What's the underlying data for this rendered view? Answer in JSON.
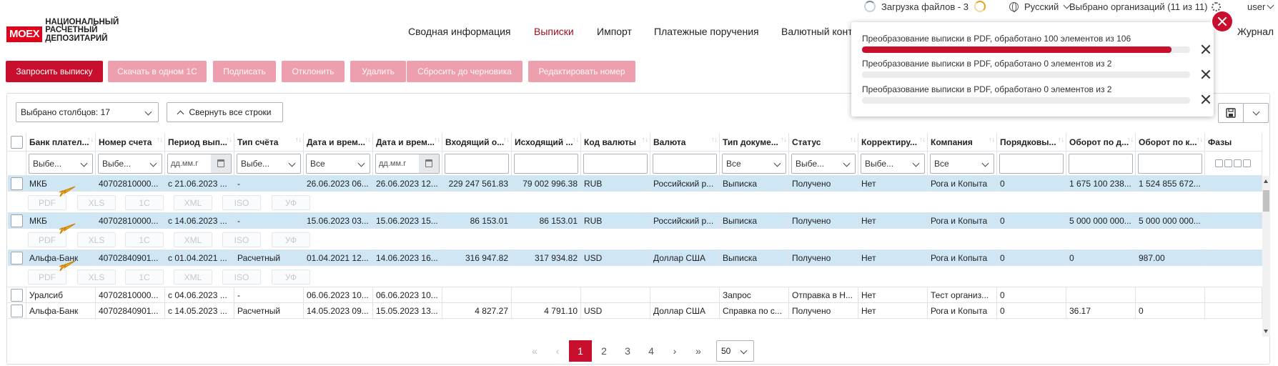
{
  "topbar": {
    "upload_label": "Загрузка файлов - 3",
    "language": "Русский",
    "orgs": "Выбрано организаций (11 из 11)",
    "user": "user"
  },
  "logo": {
    "mark": "MOEX",
    "line1": "НАЦИОНАЛЬНЫЙ",
    "line2": "РАСЧЕТНЫЙ",
    "line3": "ДЕПОЗИТАРИЙ"
  },
  "nav": [
    {
      "label": "Сводная информация"
    },
    {
      "label": "Выписки"
    },
    {
      "label": "Импорт"
    },
    {
      "label": "Платежные поручения"
    },
    {
      "label": "Валютный конт"
    },
    {
      "label": "Журнал"
    }
  ],
  "actions": [
    {
      "label": "Запросить выписку"
    },
    {
      "label": "Скачать в одном 1С"
    },
    {
      "label": "Подписать"
    },
    {
      "label": "Отклонить"
    },
    {
      "label": "Удалить"
    },
    {
      "label": "Сбросить до черновика"
    },
    {
      "label": "Редактировать номер"
    }
  ],
  "toolbar": {
    "columns_select": "Выбрано столбцов: 17",
    "collapse": "Свернуть все строки"
  },
  "columns": [
    "Банк плател...",
    "Номер счета",
    "Период вып...",
    "Тип счёта",
    "Дата и врем...",
    "Дата и врем...",
    "Входящий о...",
    "Исходящий ...",
    "Код валюты",
    "Валюта",
    "Тип докуме...",
    "Статус",
    "Корректиру...",
    "Компания",
    "Порядковы...",
    "Оборот по д...",
    "Оборот по к...",
    "Фазы"
  ],
  "filters": {
    "choose": "Выбе...",
    "all": "Все",
    "date": "дд.мм.г"
  },
  "rows": [
    [
      "МКБ",
      "40702810000...",
      "с 21.06.2023 ...",
      "-",
      "26.06.2023 06...",
      "26.06.2023 12...",
      "229 247 561.83",
      "79 002 996.38",
      "RUB",
      "Российский р...",
      "Выписка",
      "Получено",
      "Нет",
      "Рога и Копыта",
      "0",
      "1 675 100 238...",
      "1 524 855 672...",
      ""
    ],
    [
      "МКБ",
      "40702810000...",
      "с 14.06.2023 ...",
      "-",
      "15.06.2023 03...",
      "15.06.2023 15...",
      "86 153.01",
      "86 153.01",
      "RUB",
      "Российский р...",
      "Выписка",
      "Получено",
      "Нет",
      "Рога и Копыта",
      "0",
      "5 000 000 000...",
      "5 000 000 000...",
      ""
    ],
    [
      "Альфа-Банк",
      "40702840901...",
      "с 01.04.2021 ...",
      "Расчетный",
      "01.04.2021 12...",
      "14.06.2023 16...",
      "316 947.82",
      "317 934.82",
      "USD",
      "Доллар США",
      "Выписка",
      "Получено",
      "Нет",
      "Рога и Копыта",
      "0",
      "0",
      "987.00",
      ""
    ],
    [
      "Уралсиб",
      "40702810000...",
      "с 04.06.2023 ...",
      "-",
      "06.06.2023 10...",
      "06.06.2023 10...",
      "",
      "",
      "",
      "",
      "Запрос",
      "Отправка в Н...",
      "Нет",
      "Тест организ...",
      "0",
      "",
      "",
      ""
    ],
    [
      "Альфа-Банк",
      "40702840901...",
      "с 14.05.2023 ...",
      "Расчетный",
      "14.05.2023 09...",
      "15.05.2023 13...",
      "4 827.27",
      "4 791.10",
      "USD",
      "Доллар США",
      "Справка по с...",
      "Получено",
      "Нет",
      "Рога и Копыта",
      "0",
      "36.17",
      "0",
      ""
    ]
  ],
  "export_buttons": [
    "PDF",
    "XLS",
    "1C",
    "XML",
    "ISO",
    "УФ"
  ],
  "pager": {
    "first": "«",
    "prev": "‹",
    "pages": [
      "1",
      "2",
      "3",
      "4"
    ],
    "next": "›",
    "last": "»",
    "page_size": "50"
  },
  "notifications": [
    {
      "text": "Преобразование выписки в PDF, обработано 100 элементов из 106",
      "progress": 0.9434
    },
    {
      "text": "Преобразование выписки в PDF, обработано 0 элементов из 2",
      "progress": 0
    },
    {
      "text": "Преобразование выписки в PDF, обработано 0 элементов из 2",
      "progress": 0
    }
  ],
  "colors": {
    "brand": "#c8102e",
    "selected_row": "#cfe6f4",
    "arrow": "#f2a80f"
  }
}
